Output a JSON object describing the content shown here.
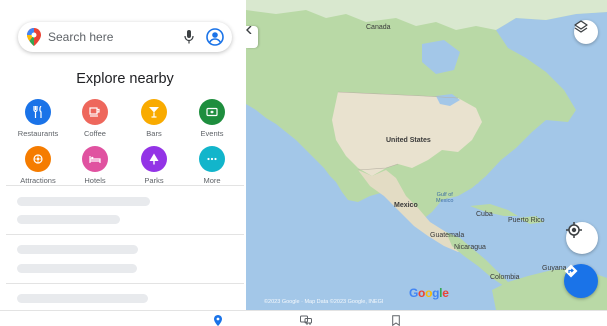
{
  "search": {
    "placeholder": "Search here"
  },
  "explore": {
    "title": "Explore nearby",
    "categories": [
      {
        "label": "Restaurants",
        "color": "#1a73e8",
        "icon": "fork-knife-icon"
      },
      {
        "label": "Coffee",
        "color": "#ee675c",
        "icon": "coffee-cup-icon"
      },
      {
        "label": "Bars",
        "color": "#f9ab00",
        "icon": "cocktail-icon"
      },
      {
        "label": "Events",
        "color": "#1e8e3e",
        "icon": "ticket-icon"
      },
      {
        "label": "Attractions",
        "color": "#f57c00",
        "icon": "ferris-wheel-icon"
      },
      {
        "label": "Hotels",
        "color": "#e052a0",
        "icon": "bed-icon"
      },
      {
        "label": "Parks",
        "color": "#9334e6",
        "icon": "tree-icon"
      },
      {
        "label": "More",
        "color": "#12b5cb",
        "icon": "more-dots-icon"
      }
    ]
  },
  "map": {
    "labels": {
      "canada": "Canada",
      "united_states": "United States",
      "gulf": "Gulf of\nMexico",
      "mexico": "Mexico",
      "cuba": "Cuba",
      "puerto_rico": "Puerto Rico",
      "guatemala": "Guatemala",
      "nicaragua": "Nicaragua",
      "colombia": "Colombia",
      "guyana": "Guyana"
    },
    "logo": "Google",
    "copyright": "©2023 Google · Map Data ©2023 Google, INEGI"
  },
  "colors": {
    "water": "#a3c7e8",
    "land_green": "#b9d9a6",
    "land_tan": "#e9e2cf",
    "accent_blue": "#1a73e8"
  }
}
